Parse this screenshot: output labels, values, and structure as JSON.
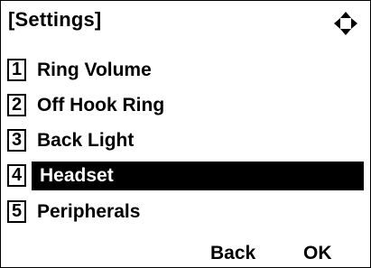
{
  "header": {
    "title": "[Settings]",
    "nav_icon": "four-way-navigation-icon"
  },
  "menu": {
    "items": [
      {
        "number": "1",
        "label": "Ring Volume"
      },
      {
        "number": "2",
        "label": "Off Hook Ring"
      },
      {
        "number": "3",
        "label": "Back Light"
      },
      {
        "number": "4",
        "label": "Headset",
        "selected": true
      },
      {
        "number": "5",
        "label": "Peripherals"
      }
    ]
  },
  "softkeys": {
    "back_label": "Back",
    "ok_label": "OK"
  },
  "colors": {
    "foreground": "#000000",
    "background": "#ffffff",
    "selection": "#000000"
  }
}
